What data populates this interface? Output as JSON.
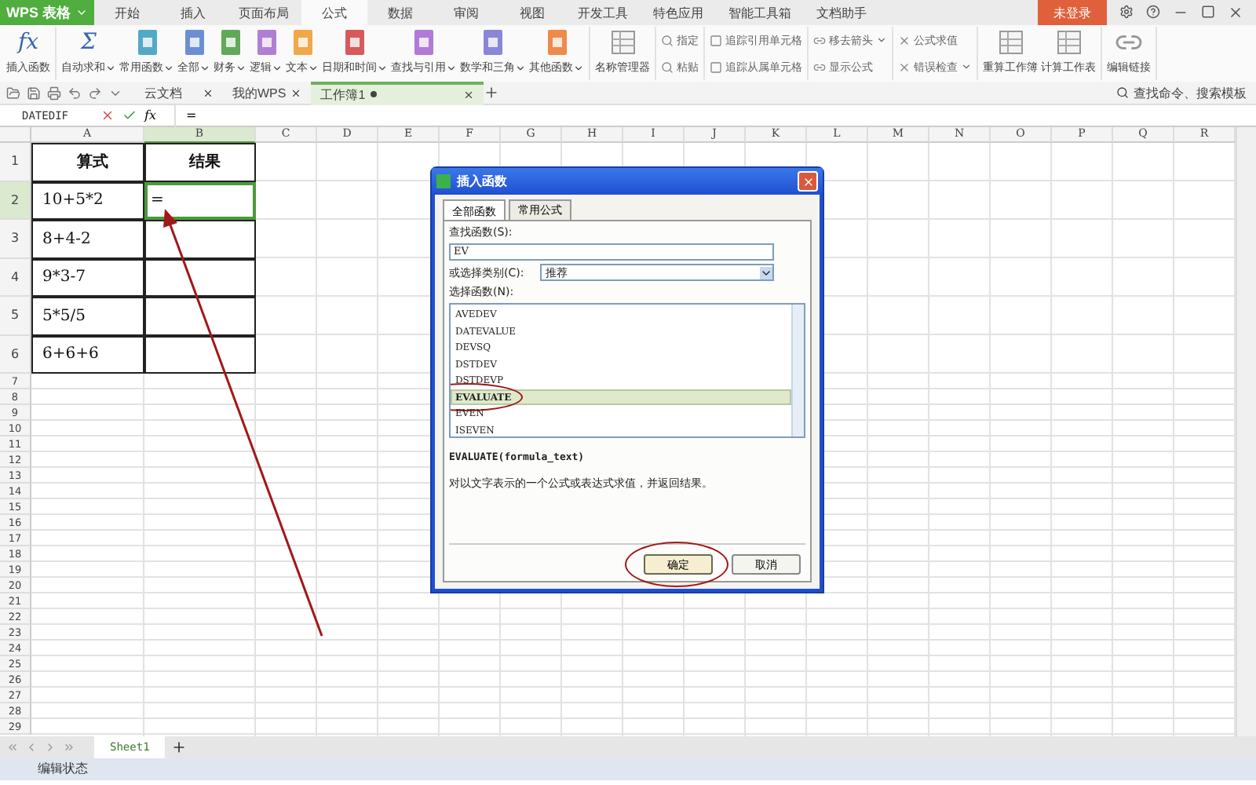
{
  "app_menu": {
    "label": "WPS 表格"
  },
  "menu_tabs": [
    {
      "label": "开始",
      "selected": false
    },
    {
      "label": "插入",
      "selected": false
    },
    {
      "label": "页面布局",
      "selected": false
    },
    {
      "label": "公式",
      "selected": true
    },
    {
      "label": "数据",
      "selected": false
    },
    {
      "label": "审阅",
      "selected": false
    },
    {
      "label": "视图",
      "selected": false
    },
    {
      "label": "开发工具",
      "selected": false
    },
    {
      "label": "特色应用",
      "selected": false
    },
    {
      "label": "智能工具箱",
      "selected": false
    },
    {
      "label": "文档助手",
      "selected": false
    }
  ],
  "login_button": {
    "label": "未登录"
  },
  "ribbon": {
    "groups": [
      {
        "kind": "large",
        "items": [
          {
            "label": "插入函数",
            "kind": "symbol",
            "symbol": "fx",
            "dropdown": false
          }
        ]
      },
      {
        "kind": "large",
        "items": [
          {
            "label": "自动求和",
            "kind": "symbol",
            "symbol": "Σ",
            "dropdown": true
          },
          {
            "label": "常用函数",
            "kind": "book",
            "color": "#52a9c6",
            "dropdown": true
          },
          {
            "label": "全部",
            "kind": "book",
            "color": "#6b8fd2",
            "dropdown": true
          },
          {
            "label": "财务",
            "kind": "book",
            "color": "#62a85a",
            "dropdown": true
          },
          {
            "label": "逻辑",
            "kind": "book",
            "color": "#b07fd2",
            "dropdown": true
          },
          {
            "label": "文本",
            "kind": "book",
            "color": "#f0a848",
            "dropdown": true
          },
          {
            "label": "日期和时间",
            "kind": "book",
            "color": "#d65a5a",
            "dropdown": true
          },
          {
            "label": "查找与引用",
            "kind": "book",
            "color": "#b27ad8",
            "dropdown": true
          },
          {
            "label": "数学和三角",
            "kind": "book",
            "color": "#8a86d8",
            "dropdown": true
          },
          {
            "label": "其他函数",
            "kind": "book",
            "color": "#f08a4a",
            "dropdown": true
          }
        ]
      },
      {
        "kind": "large",
        "items": [
          {
            "label": "名称管理器",
            "kind": "sheet",
            "dropdown": false
          }
        ]
      },
      {
        "kind": "small",
        "items": [
          {
            "label": "指定",
            "dropdown": false
          },
          {
            "label": "粘贴",
            "dropdown": false
          }
        ]
      },
      {
        "kind": "small",
        "items": [
          {
            "label": "追踪引用单元格",
            "dropdown": false
          },
          {
            "label": "追踪从属单元格",
            "dropdown": false
          }
        ]
      },
      {
        "kind": "small",
        "items": [
          {
            "label": "移去箭头",
            "dropdown": true
          },
          {
            "label": "显示公式",
            "dropdown": false
          }
        ]
      },
      {
        "kind": "small",
        "items": [
          {
            "label": "公式求值",
            "dropdown": false
          },
          {
            "label": "错误检查",
            "dropdown": true
          }
        ]
      },
      {
        "kind": "large",
        "items": [
          {
            "label": "重算工作簿",
            "kind": "sheet",
            "dropdown": false
          },
          {
            "label": "计算工作表",
            "kind": "sheet",
            "dropdown": false
          }
        ]
      },
      {
        "kind": "large",
        "items": [
          {
            "label": "编辑链接",
            "kind": "link",
            "dropdown": false
          }
        ]
      }
    ]
  },
  "doc_tabs": [
    {
      "label": "云文档",
      "selected": false,
      "modified": false
    },
    {
      "label": "我的WPS",
      "selected": false,
      "modified": false
    },
    {
      "label": "工作簿1",
      "selected": true,
      "modified": true
    }
  ],
  "search": {
    "placeholder": "查找命令、搜索模板"
  },
  "formula_bar": {
    "name_box": "DATEDIF",
    "fx_label": "fx",
    "value": "="
  },
  "columns": [
    {
      "label": "A",
      "selected": false
    },
    {
      "label": "B",
      "selected": true
    },
    {
      "label": "C",
      "selected": false
    },
    {
      "label": "D",
      "selected": false
    },
    {
      "label": "E",
      "selected": false
    },
    {
      "label": "F",
      "selected": false
    },
    {
      "label": "G",
      "selected": false
    },
    {
      "label": "H",
      "selected": false
    },
    {
      "label": "I",
      "selected": false
    },
    {
      "label": "J",
      "selected": false
    },
    {
      "label": "K",
      "selected": false
    },
    {
      "label": "L",
      "selected": false
    },
    {
      "label": "M",
      "selected": false
    },
    {
      "label": "N",
      "selected": false
    },
    {
      "label": "O",
      "selected": false
    },
    {
      "label": "P",
      "selected": false
    },
    {
      "label": "Q",
      "selected": false
    },
    {
      "label": "R",
      "selected": false
    }
  ],
  "rows": [
    {
      "number": "1",
      "kind": "heading",
      "cells": [
        {
          "text": "算式",
          "selected": false
        },
        {
          "text": "结果",
          "selected": false
        }
      ]
    },
    {
      "number": "2",
      "kind": "value",
      "cells": [
        {
          "text": "10+5*2",
          "selected": false
        },
        {
          "text": "=",
          "selected": true
        }
      ]
    },
    {
      "number": "3",
      "kind": "value",
      "cells": [
        {
          "text": "8+4-2",
          "selected": false
        },
        {
          "selected": false
        }
      ]
    },
    {
      "number": "4",
      "kind": "value",
      "cells": [
        {
          "text": "9*3-7",
          "selected": false
        },
        {
          "selected": false
        }
      ]
    },
    {
      "number": "5",
      "kind": "value",
      "cells": [
        {
          "text": "5*5/5",
          "selected": false
        },
        {
          "selected": false
        }
      ]
    },
    {
      "number": "6",
      "kind": "value",
      "cells": [
        {
          "text": "6+6+6",
          "selected": false
        },
        {
          "selected": false
        }
      ]
    },
    {
      "number": "7"
    },
    {
      "number": "8"
    },
    {
      "number": "9"
    },
    {
      "number": "10"
    },
    {
      "number": "11"
    },
    {
      "number": "12"
    },
    {
      "number": "13"
    },
    {
      "number": "14"
    },
    {
      "number": "15"
    },
    {
      "number": "16"
    },
    {
      "number": "17"
    },
    {
      "number": "18"
    },
    {
      "number": "19"
    },
    {
      "number": "20"
    },
    {
      "number": "21"
    },
    {
      "number": "22"
    },
    {
      "number": "23"
    },
    {
      "number": "24"
    },
    {
      "number": "25"
    },
    {
      "number": "26"
    },
    {
      "number": "27"
    },
    {
      "number": "28"
    },
    {
      "number": "29"
    }
  ],
  "dialog": {
    "title": "插入函数",
    "tabs": [
      {
        "label": "全部函数",
        "selected": true
      },
      {
        "label": "常用公式",
        "selected": false
      }
    ],
    "search_label": "查找函数(S):",
    "search_value": "EV",
    "category_label": "或选择类别(C):",
    "category_value": "推荐",
    "list_label": "选择函数(N):",
    "functions": [
      {
        "name": "AVEDEV",
        "selected": false
      },
      {
        "name": "DATEVALUE",
        "selected": false
      },
      {
        "name": "DEVSQ",
        "selected": false
      },
      {
        "name": "DSTDEV",
        "selected": false
      },
      {
        "name": "DSTDEVP",
        "selected": false
      },
      {
        "name": "EVALUATE",
        "selected": true
      },
      {
        "name": "EVEN",
        "selected": false
      },
      {
        "name": "ISEVEN",
        "selected": false
      }
    ],
    "signature": "EVALUATE(formula_text)",
    "description": "对以文字表示的一个公式或表达式求值，并返回结果。",
    "buttons": [
      {
        "label": "确定",
        "default": true
      },
      {
        "label": "取消",
        "default": false
      }
    ]
  },
  "sheet_tabs": [
    {
      "label": "Sheet1",
      "selected": true
    }
  ],
  "status_bar": {
    "text": "编辑状态"
  }
}
